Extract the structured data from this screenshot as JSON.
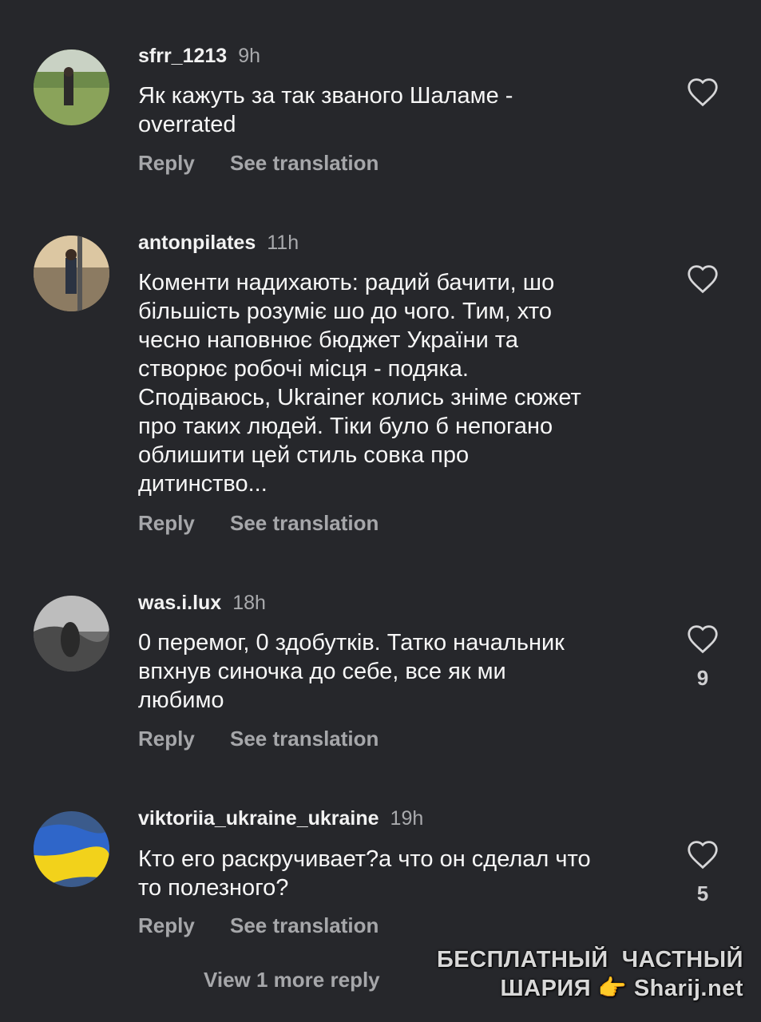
{
  "comments": [
    {
      "username": "sfrr_1213",
      "time": "9h",
      "text": "Як кажуть за так званого Шаламе -\noverrated",
      "reply_label": "Reply",
      "translate_label": "See translation",
      "likes": ""
    },
    {
      "username": "antonpilates",
      "time": "11h",
      "text": "Коменти надихають: радий бачити, шо\nбільшість розуміє шо до чого. Тим, хто\nчесно наповнює бюджет України та\nстворює робочі місця - подяка.\nСподіваюсь, Ukrainer колись зніме сюжет\nпро таких людей. Тіки було б непогано\nоблишити цей стиль совка про\nдитинство...",
      "reply_label": "Reply",
      "translate_label": "See translation",
      "likes": ""
    },
    {
      "username": "was.i.lux",
      "time": "18h",
      "text": "0 перемог, 0 здобутків. Татко начальник\nвпхнув синочка до себе, все як ми\nлюбимо",
      "reply_label": "Reply",
      "translate_label": "See translation",
      "likes": "9"
    },
    {
      "username": "viktoriia_ukraine_ukraine",
      "time": "19h",
      "text": "Кто его раскручивает?а что он сделал что\nто полезного?",
      "reply_label": "Reply",
      "translate_label": "See translation",
      "likes": "5"
    }
  ],
  "view_more_label": "View 1 more reply",
  "watermark": {
    "line1": "БЕСПЛАТНЫЙ  ЧАСТНЫЙ",
    "line2_left": "ШАРИЯ",
    "line2_right": "Sharij.net"
  },
  "icons": {
    "like": "heart-outline-icon",
    "pointing": "pointing-hand-icon"
  },
  "colors": {
    "background": "#26272b",
    "text": "#f7f7f7",
    "muted": "#a6a7aa"
  }
}
